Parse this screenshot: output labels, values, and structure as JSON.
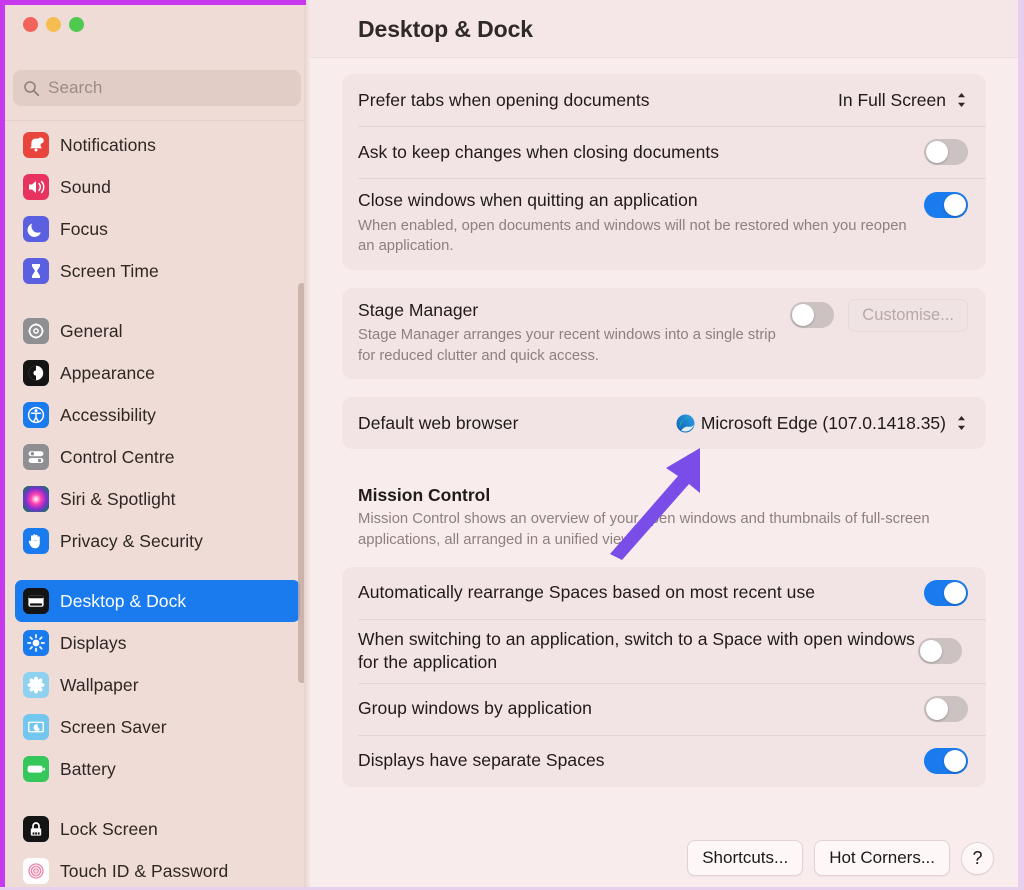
{
  "window": {
    "title": "Desktop & Dock",
    "traffic_lights": [
      "close",
      "minimise",
      "zoom"
    ]
  },
  "sidebar": {
    "search": {
      "placeholder": "Search",
      "value": "",
      "icon": "search-icon"
    },
    "groups": [
      {
        "items": [
          {
            "label": "Notifications",
            "icon": "notifications-icon",
            "active": false
          },
          {
            "label": "Sound",
            "icon": "sound-icon",
            "active": false
          },
          {
            "label": "Focus",
            "icon": "focus-icon",
            "active": false
          },
          {
            "label": "Screen Time",
            "icon": "screen-time-icon",
            "active": false
          }
        ]
      },
      {
        "items": [
          {
            "label": "General",
            "icon": "general-icon",
            "active": false
          },
          {
            "label": "Appearance",
            "icon": "appearance-icon",
            "active": false
          },
          {
            "label": "Accessibility",
            "icon": "accessibility-icon",
            "active": false
          },
          {
            "label": "Control Centre",
            "icon": "control-centre-icon",
            "active": false
          },
          {
            "label": "Siri & Spotlight",
            "icon": "siri-icon",
            "active": false
          },
          {
            "label": "Privacy & Security",
            "icon": "privacy-icon",
            "active": false
          }
        ]
      },
      {
        "items": [
          {
            "label": "Desktop & Dock",
            "icon": "desktop-dock-icon",
            "active": true
          },
          {
            "label": "Displays",
            "icon": "displays-icon",
            "active": false
          },
          {
            "label": "Wallpaper",
            "icon": "wallpaper-icon",
            "active": false
          },
          {
            "label": "Screen Saver",
            "icon": "screen-saver-icon",
            "active": false
          },
          {
            "label": "Battery",
            "icon": "battery-icon",
            "active": false
          }
        ]
      },
      {
        "items": [
          {
            "label": "Lock Screen",
            "icon": "lock-screen-icon",
            "active": false
          },
          {
            "label": "Touch ID & Password",
            "icon": "touch-id-icon",
            "active": false
          }
        ]
      }
    ]
  },
  "main": {
    "windows_card": {
      "prefer_tabs": {
        "label": "Prefer tabs when opening documents",
        "value": "In Full Screen",
        "control": "popup-button"
      },
      "ask_keep_changes": {
        "label": "Ask to keep changes when closing documents",
        "control": "toggle",
        "state": "off"
      },
      "close_windows": {
        "label": "Close windows when quitting an application",
        "description": "When enabled, open documents and windows will not be restored when you reopen an application.",
        "control": "toggle",
        "state": "on"
      }
    },
    "stage_manager_card": {
      "label": "Stage Manager",
      "description": "Stage Manager arranges your recent windows into a single strip for reduced clutter and quick access.",
      "control": "toggle",
      "state": "off",
      "customise_button": "Customise..."
    },
    "browser_card": {
      "label": "Default web browser",
      "value": "Microsoft Edge (107.0.1418.35)",
      "icon": "microsoft-edge-icon",
      "control": "popup-button"
    },
    "mission_control": {
      "title": "Mission Control",
      "description": "Mission Control shows an overview of your open windows and thumbnails of full-screen applications, all arranged in a unified view."
    },
    "spaces_card": {
      "rows": [
        {
          "label": "Automatically rearrange Spaces based on most recent use",
          "control": "toggle",
          "state": "on"
        },
        {
          "label": "When switching to an application, switch to a Space with open windows for the application",
          "control": "toggle",
          "state": "off"
        },
        {
          "label": "Group windows by application",
          "control": "toggle",
          "state": "off"
        },
        {
          "label": "Displays have separate Spaces",
          "control": "toggle",
          "state": "on"
        }
      ]
    },
    "footer": {
      "shortcuts": "Shortcuts...",
      "hot_corners": "Hot Corners...",
      "help": "?"
    }
  },
  "annotation": {
    "type": "arrow",
    "color": "#7B4DE8",
    "points_to": "Default web browser value"
  },
  "colors": {
    "accent": "#1a7bef",
    "sidebar_bg": "#f0dcd7",
    "content_bg": "#f8eced",
    "card_bg": "#f2e3e4",
    "annotation_purple": "#7B4DE8",
    "frame_purple": "#c838ec"
  }
}
